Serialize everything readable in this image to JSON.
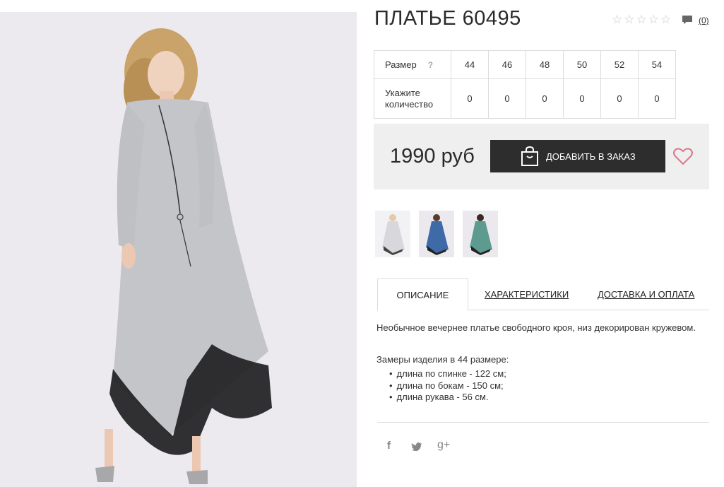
{
  "product": {
    "title": "ПЛАТЬЕ 60495",
    "review_count": "(0)",
    "rating_stars": 5,
    "price": "1990 руб",
    "add_button_label": "ДОБАВИТЬ В ЗАКАЗ"
  },
  "sizes": {
    "header_label": "Размер",
    "help_mark": "?",
    "quantity_label": "Укажите количество",
    "columns": [
      "44",
      "46",
      "48",
      "50",
      "52",
      "54"
    ],
    "quantities": [
      "0",
      "0",
      "0",
      "0",
      "0",
      "0"
    ]
  },
  "thumbnails": [
    {
      "name": "silver",
      "color": "#d8d8dc"
    },
    {
      "name": "blue",
      "color": "#3f6aa8"
    },
    {
      "name": "teal",
      "color": "#5d9a8f"
    }
  ],
  "tabs": {
    "description": "ОПИСАНИЕ",
    "characteristics": "ХАРАКТЕРИСТИКИ",
    "delivery": "ДОСТАВКА И ОПЛАТА"
  },
  "description": {
    "text": "Необычное вечернее платье свободного кроя, низ декорирован кружевом.",
    "measures_title": "Замеры изделия в 44 размере:",
    "measures": [
      "длина по спинке - 122 см;",
      "длина по бокам - 150 см;",
      "длина рукава - 56 см."
    ]
  },
  "social": {
    "facebook": "f",
    "twitter": "twitter-icon",
    "googleplus": "g+"
  },
  "colors": {
    "button_bg": "#2d2d2d",
    "price_box_bg": "#efefef",
    "heart": "#d9768c",
    "photo_bg": "#eceaef"
  }
}
